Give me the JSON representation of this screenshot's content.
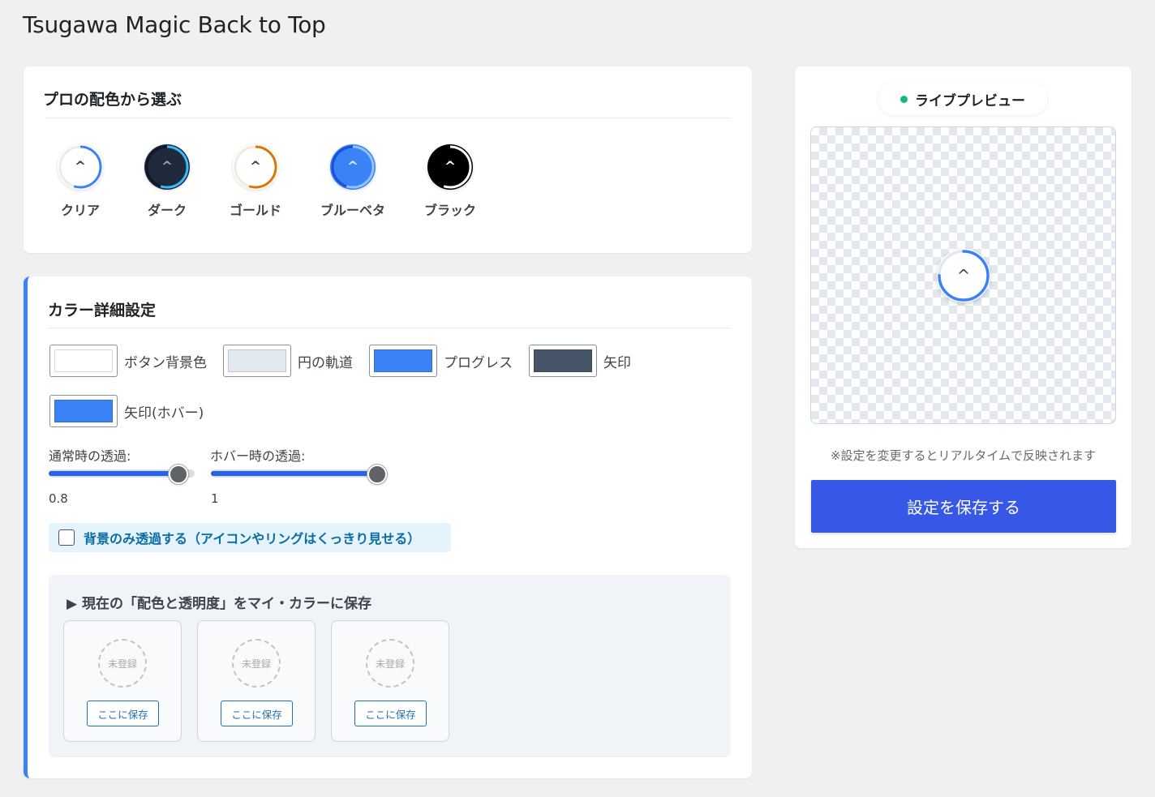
{
  "page": {
    "title": "Tsugawa Magic Back to Top"
  },
  "presets": {
    "heading": "プロの配色から選ぶ",
    "items": [
      {
        "label": "クリア",
        "bg": "#ffffff",
        "track": "#e8ecf1",
        "ring": "#3b82f6",
        "arrow": "#3c434a"
      },
      {
        "label": "ダーク",
        "bg": "#1e2a3b",
        "track": "#0f172a",
        "ring": "#38bdf8",
        "arrow": "#94a3b8"
      },
      {
        "label": "ゴールド",
        "bg": "#ffffff",
        "track": "#efe9e0",
        "ring": "#d97706",
        "arrow": "#3c434a"
      },
      {
        "label": "ブルーベタ",
        "bg": "#3b82f6",
        "track": "#1d4ed8",
        "ring": "#93c5fd",
        "arrow": "#dbeafe"
      },
      {
        "label": "ブラック",
        "bg": "#000000",
        "track": "#000000",
        "ring": "#ffffff",
        "arrow": "#ffffff"
      }
    ],
    "caret": "^"
  },
  "details": {
    "heading": "カラー詳細設定",
    "swatches": [
      {
        "label": "ボタン背景色",
        "color": "#ffffff"
      },
      {
        "label": "円の軌道",
        "color": "#e2e8f0"
      },
      {
        "label": "プログレス",
        "color": "#3b82f6"
      },
      {
        "label": "矢印",
        "color": "#475569"
      },
      {
        "label": "矢印(ホバー)",
        "color": "#3b82f6"
      }
    ],
    "opacity_normal": {
      "label": "通常時の透過:",
      "value": "0.8",
      "fraction": 0.8
    },
    "opacity_hover": {
      "label": "ホバー時の透過:",
      "value": "1",
      "fraction": 1
    },
    "bg_only": {
      "label": "背景のみ透過する（アイコンやリングはくっきり見せる）",
      "checked": false
    },
    "mycolor": {
      "title": "▶ 現在の「配色と透明度」をマイ・カラーに保存",
      "slots": [
        {
          "status": "未登録",
          "button": "ここに保存"
        },
        {
          "status": "未登録",
          "button": "ここに保存"
        },
        {
          "status": "未登録",
          "button": "ここに保存"
        }
      ]
    }
  },
  "preview": {
    "badge": "ライブプレビュー",
    "caret": "^",
    "note": "※設定を変更するとリアルタイムで反映されます",
    "save_button": "設定を保存する",
    "progress_fraction": 0.75
  },
  "colors": {
    "accent": "#3b82f6",
    "save_button": "#3758e6",
    "live_dot": "#10b981"
  }
}
